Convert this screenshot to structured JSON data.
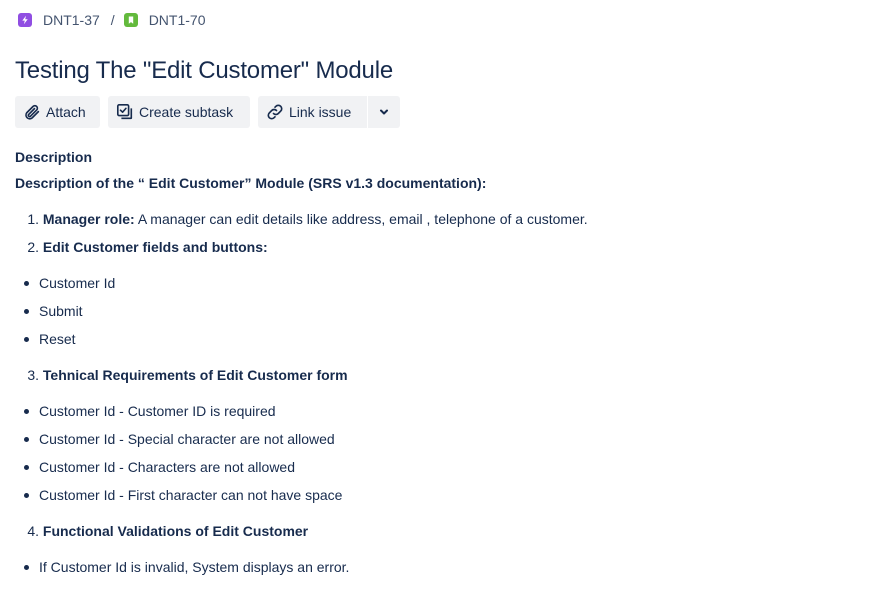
{
  "breadcrumb": {
    "parent": {
      "key": "DNT1-37",
      "icon": "lightning-icon",
      "color": "#904ee2"
    },
    "separator": "/",
    "current": {
      "key": "DNT1-70",
      "icon": "bookmark-icon",
      "color": "#63ba3c"
    }
  },
  "issue": {
    "title": "Testing The \"Edit Customer\" Module"
  },
  "actions": {
    "attach": "Attach",
    "create_subtask": "Create subtask",
    "link_issue": "Link issue"
  },
  "description": {
    "label": "Description",
    "heading": "Description of the “ Edit Customer” Module (SRS v1.3 documentation):",
    "item1_num": "1.",
    "item1_bold": "Manager role:",
    "item1_text": " A manager can edit details like address, email , telephone of a customer.",
    "item2_num": "2.",
    "item2_bold": "Edit Customer fields and buttons:",
    "fields": [
      "Customer Id",
      "Submit",
      "Reset"
    ],
    "item3_num": "3.",
    "item3_bold": "Tehnical Requirements of Edit Customer form",
    "requirements": [
      "Customer Id - Customer ID is required",
      "Customer Id - Special character are not allowed",
      "Customer Id - Characters are not allowed",
      "Customer Id - First character can not have space"
    ],
    "item4_num": "4.",
    "item4_bold": "Functional Validations of Edit Customer",
    "validations": [
      "If Customer Id is invalid, System displays an error."
    ]
  }
}
